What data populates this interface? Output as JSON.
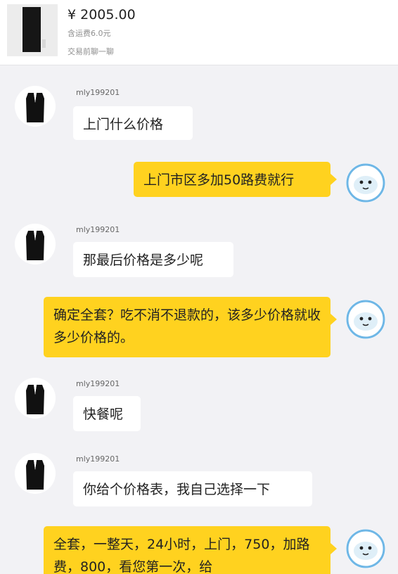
{
  "header": {
    "price": "¥ 2005.00",
    "shipping": "含运费6.0元",
    "chat_hint": "交易前聊一聊"
  },
  "icons": {
    "other_avatar": "vest-avatar-icon",
    "self_avatar": "fish-avatar-icon"
  },
  "colors": {
    "outgoing_bubble": "#ffd21f",
    "incoming_bubble": "#ffffff",
    "background": "#f2f2f5"
  },
  "messages": [
    {
      "sender": "mly199201",
      "text": "上门什么价格"
    },
    {
      "text": "上门市区多加50路费就行"
    },
    {
      "sender": "mly199201",
      "text": "那最后价格是多少呢"
    },
    {
      "text": "确定全套？吃不消不退款的，该多少价格就收多少价格的。"
    },
    {
      "sender": "mly199201",
      "text": "快餐呢"
    },
    {
      "sender": "mly199201",
      "text": "你给个价格表，我自己选择一下"
    },
    {
      "text": "全套，一整天，24小时，上门，750，加路费，800，看您第一次，给"
    }
  ]
}
